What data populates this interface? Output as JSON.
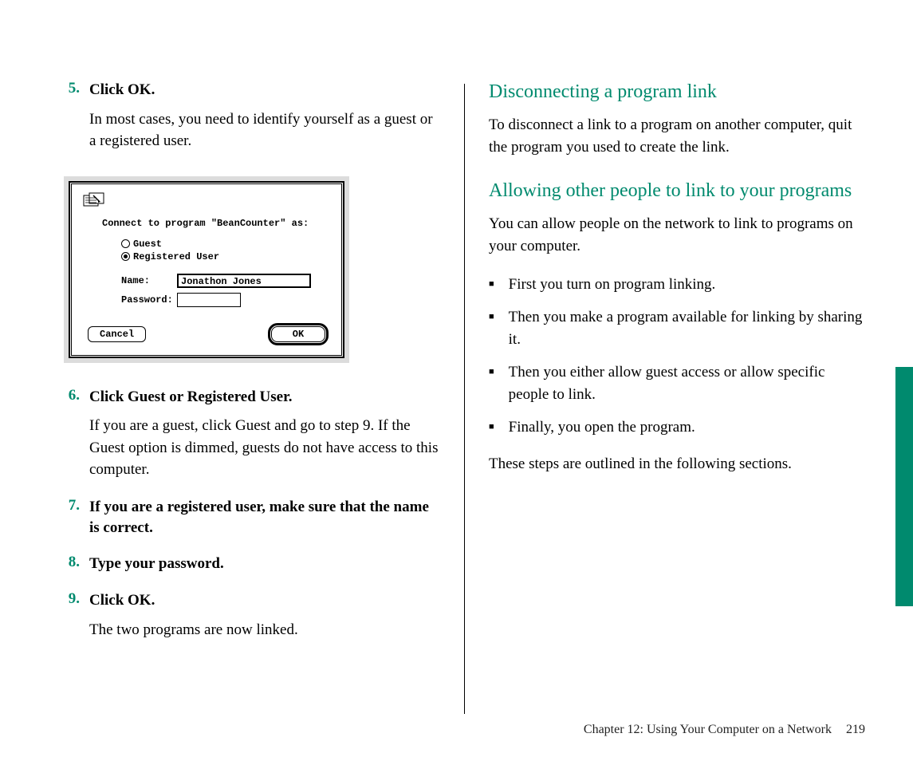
{
  "left": {
    "steps": [
      {
        "num": "5.",
        "title": "Click OK.",
        "body": "In most cases, you need to identify yourself as a guest or a registered user."
      },
      {
        "num": "6.",
        "title": "Click Guest or Registered User.",
        "body": "If you are a guest, click Guest and go to step 9. If the Guest option is dimmed, guests do not have access to this computer."
      },
      {
        "num": "7.",
        "title": "If you are a registered user, make sure that the name is correct.",
        "body": ""
      },
      {
        "num": "8.",
        "title": "Type your password.",
        "body": ""
      },
      {
        "num": "9.",
        "title": "Click OK.",
        "body": "The two programs are now linked."
      }
    ]
  },
  "dialog": {
    "prompt": "Connect to program \"BeanCounter\" as:",
    "radio_guest": "Guest",
    "radio_registered": "Registered User",
    "name_label": "Name:",
    "name_value": "Jonathon Jones",
    "password_label": "Password:",
    "cancel": "Cancel",
    "ok": "OK"
  },
  "right": {
    "h1": "Disconnecting a program link",
    "p1": "To disconnect a link to a program on another computer, quit the program you used to create the link.",
    "h2": "Allowing other people to link to your programs",
    "p2": "You can allow people on the network to link to programs on your computer.",
    "bullets": [
      "First you turn on program linking.",
      "Then you make a program available for linking by sharing it.",
      "Then you either allow guest access or allow specific people to link.",
      "Finally, you open the program."
    ],
    "p3": "These steps are outlined in the following sections."
  },
  "footer": {
    "chapter": "Chapter 12: Using Your Computer on a Network",
    "page": "219"
  }
}
